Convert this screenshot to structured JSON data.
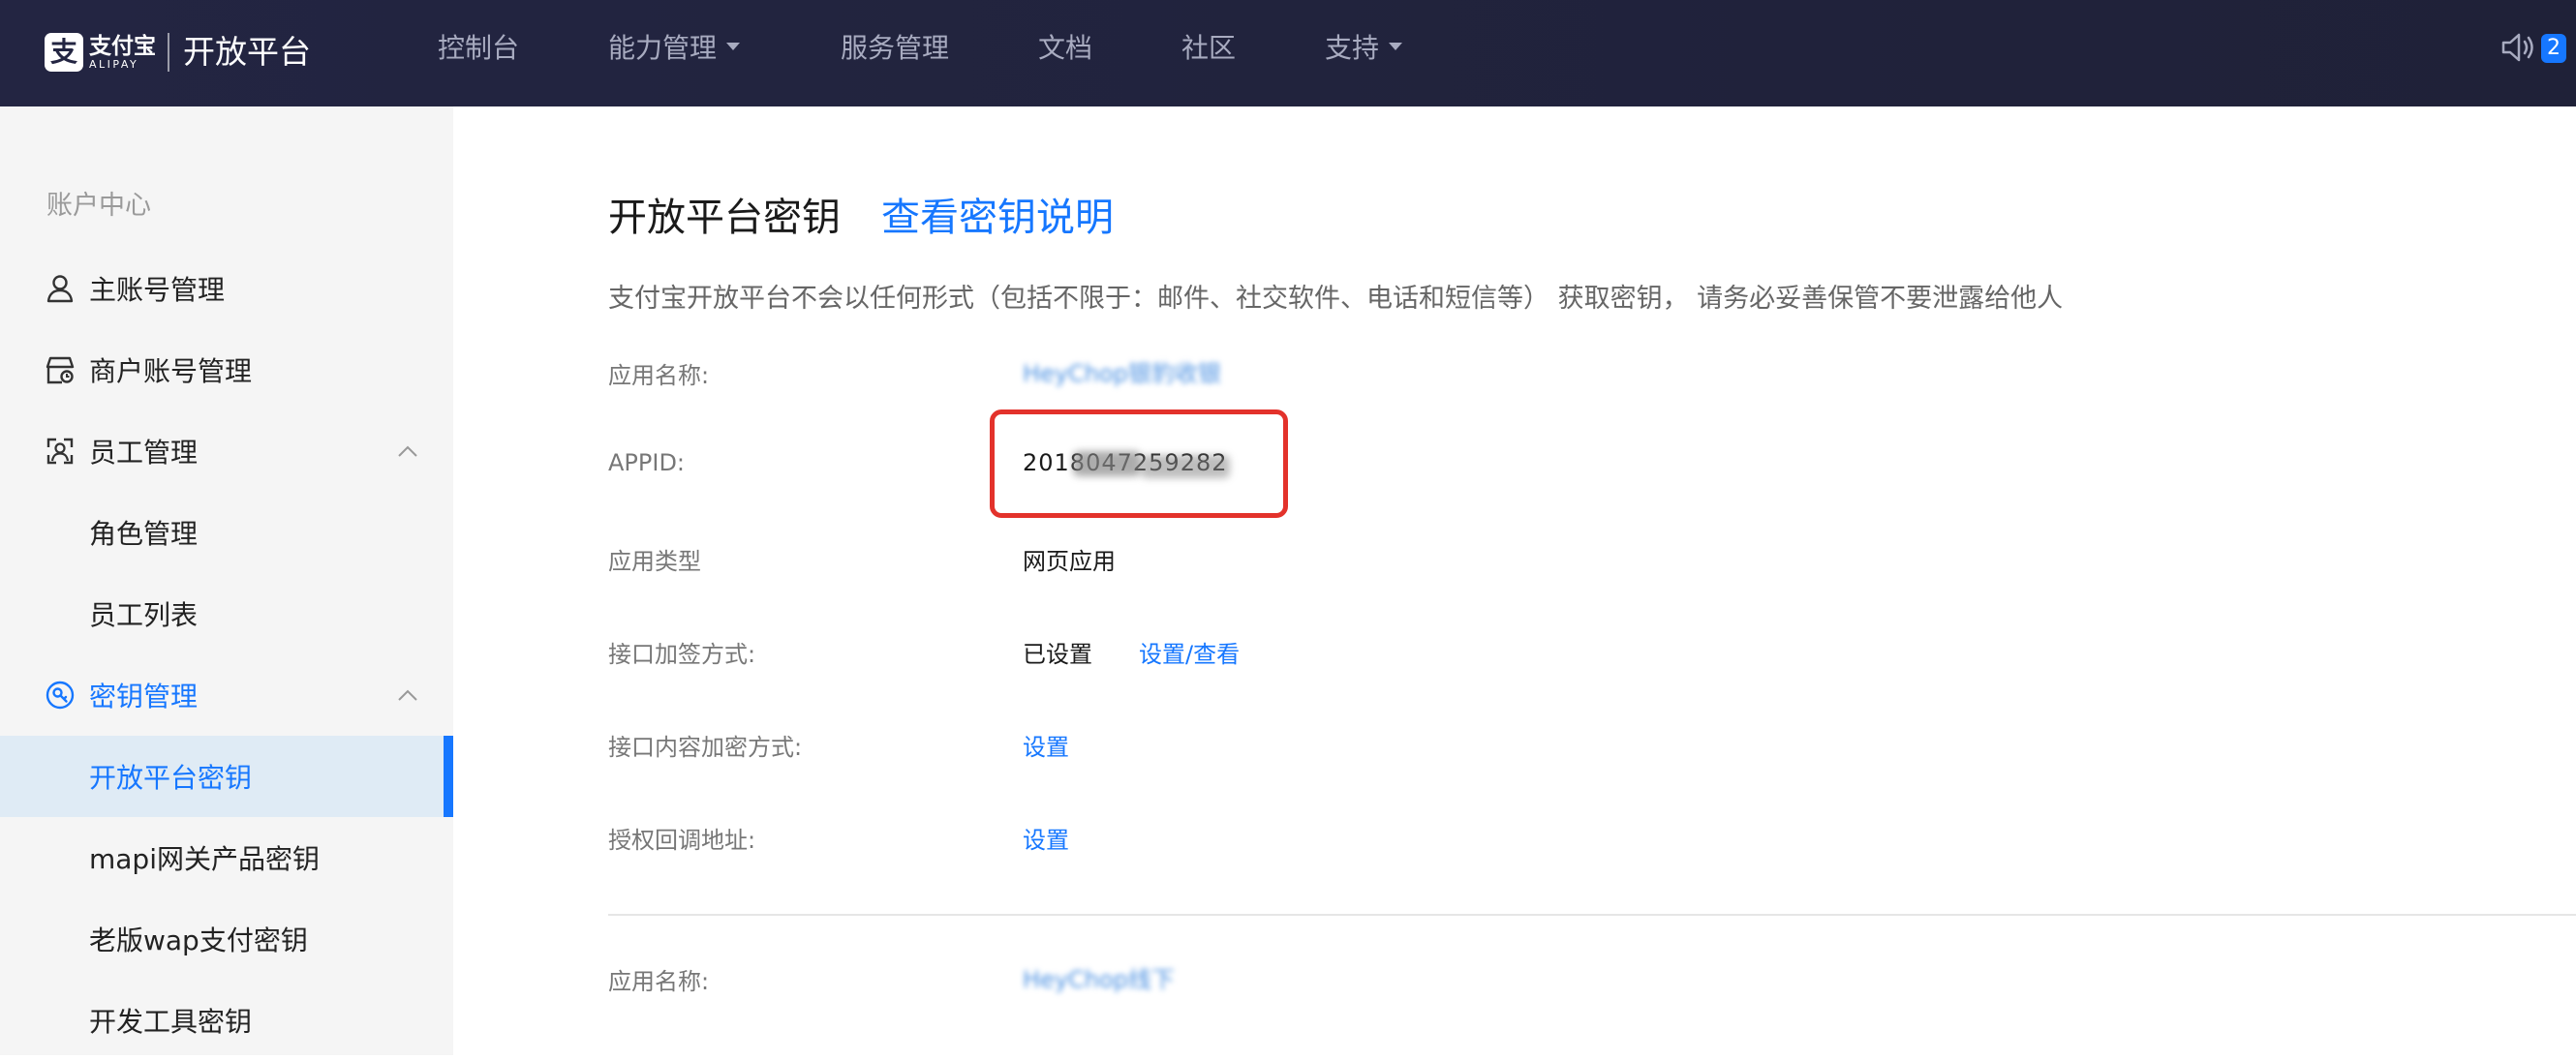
{
  "brand": {
    "mark": "支",
    "name_cn": "支付宝",
    "name_en": "ALIPAY",
    "product": "开放平台"
  },
  "topnav": [
    {
      "label": "控制台",
      "dropdown": false
    },
    {
      "label": "能力管理",
      "dropdown": true
    },
    {
      "label": "服务管理",
      "dropdown": false
    },
    {
      "label": "文档",
      "dropdown": false
    },
    {
      "label": "社区",
      "dropdown": false
    },
    {
      "label": "支持",
      "dropdown": true
    }
  ],
  "notice_count": "2",
  "sidebar": {
    "header": "账户中心",
    "items": [
      {
        "label": "主账号管理",
        "icon": "user-icon"
      },
      {
        "label": "商户账号管理",
        "icon": "merchant-icon"
      },
      {
        "label": "员工管理",
        "icon": "staff-icon"
      },
      {
        "label": "角色管理"
      },
      {
        "label": "员工列表"
      },
      {
        "label": "密钥管理",
        "icon": "key-icon"
      },
      {
        "label": "开放平台密钥"
      },
      {
        "label": "mapi网关产品密钥"
      },
      {
        "label": "老版wap支付密钥"
      },
      {
        "label": "开发工具密钥"
      }
    ]
  },
  "main": {
    "title": "开放平台密钥",
    "doc_link": "查看密钥说明",
    "warning": "支付宝开放平台不会以任何形式（包括不限于：邮件、社交软件、电话和短信等） 获取密钥， 请务必妥善保管不要泄露给他人",
    "fields": {
      "app_name_label": "应用名称:",
      "app_name_value": "HeyChop银豹收银",
      "appid_label": "APPID:",
      "appid_value": "2018047259282",
      "app_type_label": "应用类型",
      "app_type_value": "网页应用",
      "sign_label": "接口加签方式:",
      "sign_value": "已设置",
      "sign_link": "设置/查看",
      "encrypt_label": "接口内容加密方式:",
      "encrypt_link": "设置",
      "callback_label": "授权回调地址:",
      "callback_link": "设置"
    },
    "second_app": {
      "app_name_label": "应用名称:",
      "app_name_value": "HeyChop线下"
    }
  },
  "colors": {
    "accent": "#1677ff",
    "topbar": "#232542",
    "highlight_box": "#e3322b"
  }
}
